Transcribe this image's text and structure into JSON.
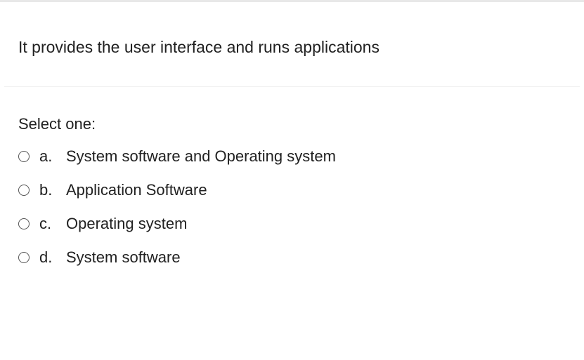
{
  "question": {
    "text": "It provides the user interface and runs applications"
  },
  "select_label": "Select one:",
  "options": [
    {
      "letter": "a.",
      "text": "System software and Operating system"
    },
    {
      "letter": "b.",
      "text": "Application Software"
    },
    {
      "letter": "c.",
      "text": "Operating system"
    },
    {
      "letter": "d.",
      "text": "System software"
    }
  ]
}
